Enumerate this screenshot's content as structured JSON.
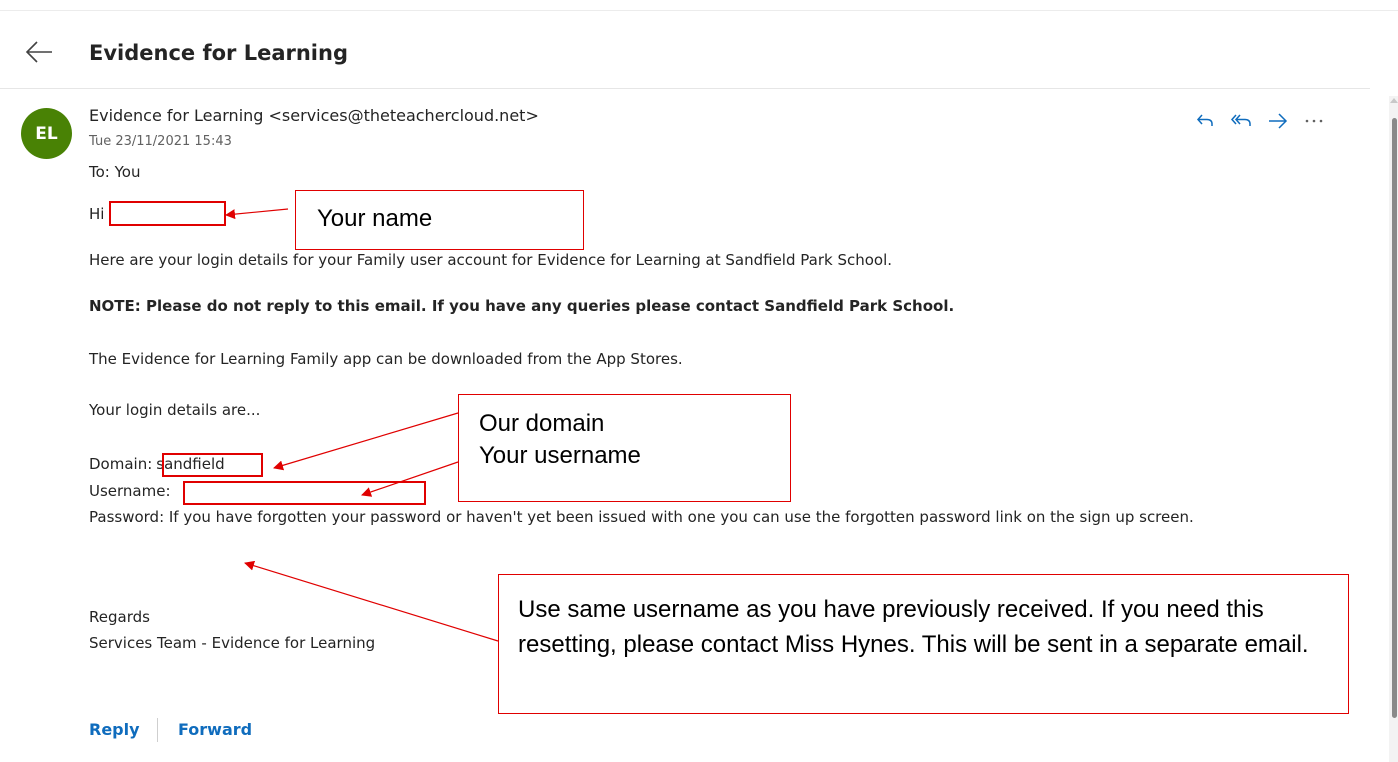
{
  "header": {
    "subject": "Evidence for Learning"
  },
  "message": {
    "avatar_initials": "EL",
    "sender": "Evidence for Learning <services@theteachercloud.net>",
    "datetime": "Tue 23/11/2021 15:43",
    "to": "To: You",
    "actions": [
      "reply-icon",
      "reply-all-icon",
      "forward-icon",
      "more-icon"
    ],
    "body": {
      "greeting": "Hi",
      "intro": "Here are your login details for your Family user account for Evidence for Learning at Sandfield Park School.",
      "note": "NOTE: Please do not reply to this email. If you have any queries please contact Sandfield Park School.",
      "app_line": "The Evidence for Learning Family app can be downloaded from the App Stores.",
      "login_intro": "Your login details are...",
      "domain_label": "Domain:",
      "domain_value": "sandfield",
      "username_label": "Username:",
      "password_line": "Password: If you have forgotten your password or haven't yet been issued with one you can use the forgotten password link on the sign up screen.",
      "regards": "Regards",
      "signature": "Services Team - Evidence for Learning"
    }
  },
  "footer": {
    "reply_label": "Reply",
    "forward_label": "Forward"
  },
  "annotations": {
    "name_callout": "Your name",
    "domain_callout": "Our domain",
    "username_callout": "Your username",
    "password_callout": "Use same username as you have previously received. If you need this resetting, please contact Miss Hynes. This will be sent in a separate email.",
    "color": "#e00000"
  },
  "colors": {
    "avatar": "#498205",
    "link": "#0f6cbd"
  }
}
